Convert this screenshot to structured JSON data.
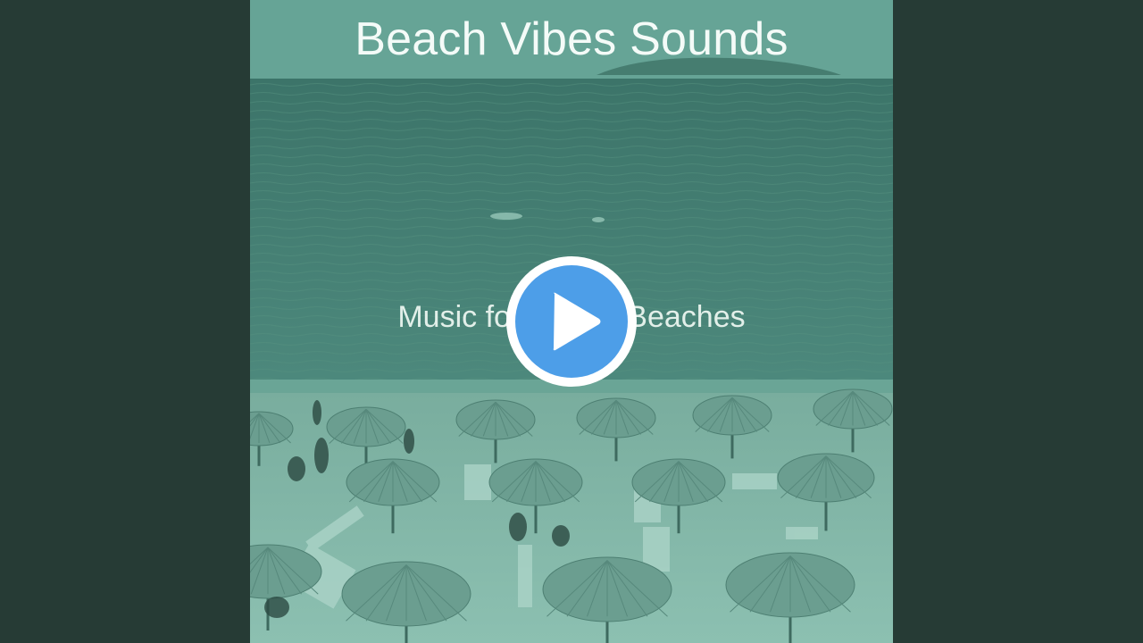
{
  "video": {
    "title": "Beach Vibes Sounds",
    "subtitle": "Music for Stylish Beaches",
    "play_button": {
      "icon": "play-icon",
      "color": "#4d9ee8"
    }
  },
  "colors": {
    "letterbox": "#263b35",
    "sky": "#5f9c8e",
    "sea_top": "#3f786d",
    "sea_bottom": "#4f8c80",
    "sand": "#7fb5a5"
  }
}
